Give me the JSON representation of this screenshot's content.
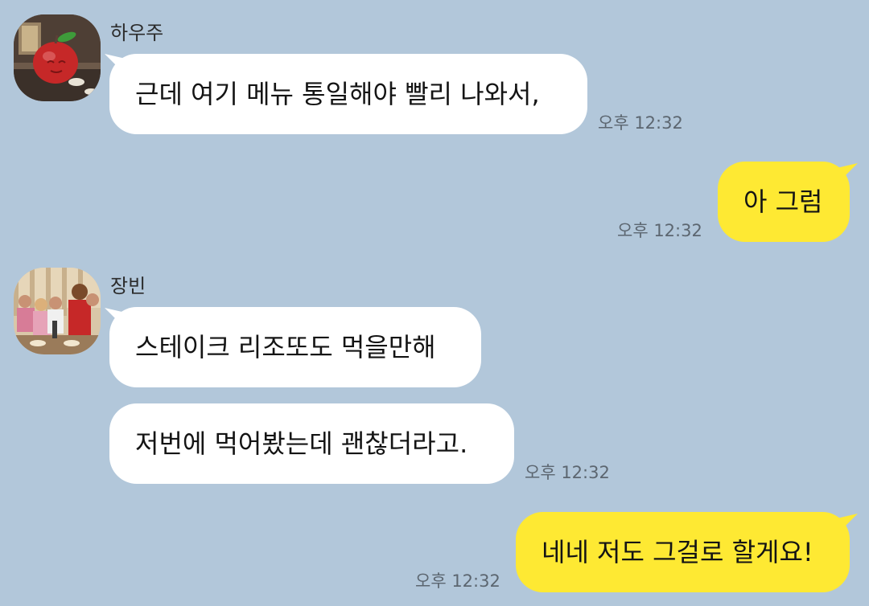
{
  "colors": {
    "background": "#b2c7da",
    "incoming_bubble": "#ffffff",
    "outgoing_bubble": "#fee933",
    "timestamp": "#5c6670"
  },
  "messages": [
    {
      "sender": "하우주",
      "text": "근데 여기 메뉴 통일해야 빨리 나와서,",
      "time": "오후 12:32",
      "direction": "incoming"
    },
    {
      "text": "아 그럼",
      "time": "오후 12:32",
      "direction": "outgoing"
    },
    {
      "sender": "장빈",
      "text": "스테이크 리조또도 먹을만해",
      "direction": "incoming"
    },
    {
      "text": "저번에 먹어봤는데 괜찮더라고.",
      "time": "오후 12:32",
      "direction": "incoming"
    },
    {
      "text": "네네 저도 그걸로 할게요!",
      "time": "오후 12:32",
      "direction": "outgoing"
    }
  ],
  "avatars": {
    "first": "apple-avatar",
    "second": "group-photo-avatar"
  }
}
